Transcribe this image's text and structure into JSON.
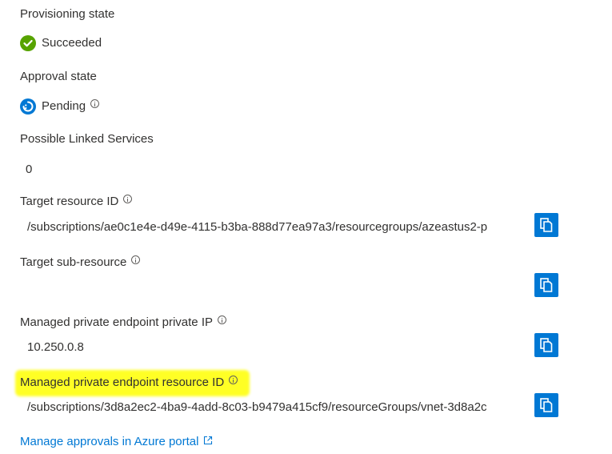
{
  "provisioning": {
    "label": "Provisioning state",
    "value": "Succeeded",
    "icon": "success-check-icon",
    "color": "#57a300"
  },
  "approval": {
    "label": "Approval state",
    "value": "Pending",
    "icon": "pending-icon",
    "color": "#0078d4"
  },
  "linked_services": {
    "label": "Possible Linked Services",
    "value": "0"
  },
  "target_resource_id": {
    "label": "Target resource ID",
    "value": "/subscriptions/ae0c1e4e-d49e-4115-b3ba-888d77ea97a3/resourcegroups/azeastus2-p"
  },
  "target_sub_resource": {
    "label": "Target sub-resource",
    "value": ""
  },
  "private_ip": {
    "label": "Managed private endpoint private IP",
    "value": "10.250.0.8"
  },
  "endpoint_resource_id": {
    "label": "Managed private endpoint resource ID",
    "value": "/subscriptions/3d8a2ec2-4ba9-4add-8c03-b9479a415cf9/resourceGroups/vnet-3d8a2c"
  },
  "manage_link": {
    "label": "Manage approvals in Azure portal"
  },
  "colors": {
    "accent": "#0078d4",
    "highlight": "#ffff00",
    "text": "#323130"
  }
}
